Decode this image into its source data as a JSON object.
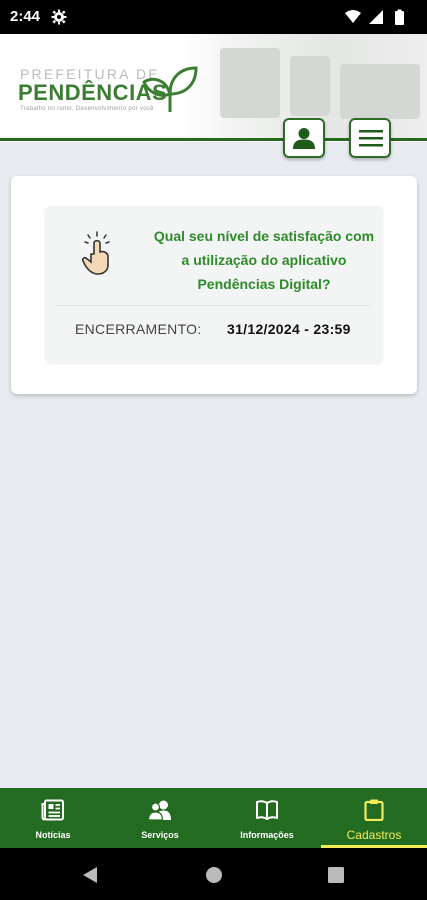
{
  "status_bar": {
    "time": "2:44"
  },
  "header": {
    "logo_top": "PREFEITURA DE",
    "logo_main": "PENDÊNCIAS",
    "logo_sub": "Trabalho no rumo, Desenvolvimento por você",
    "accent_color": "#256a1e"
  },
  "survey": {
    "question": "Qual seu nível de satisfação com a utilização do aplicativo Pendências Digital?",
    "close_label": "ENCERRAMENTO:",
    "close_value": "31/12/2024 - 23:59",
    "question_color": "#2e8b2a"
  },
  "bottom_nav": {
    "items": [
      {
        "label": "Notícias",
        "icon": "newspaper-icon"
      },
      {
        "label": "Serviços",
        "icon": "people-icon"
      },
      {
        "label": "Informações",
        "icon": "book-icon"
      },
      {
        "label": "Cadastros",
        "icon": "clipboard-icon",
        "active": true
      }
    ],
    "active_color": "#f2ec5a",
    "background": "#246b22"
  }
}
